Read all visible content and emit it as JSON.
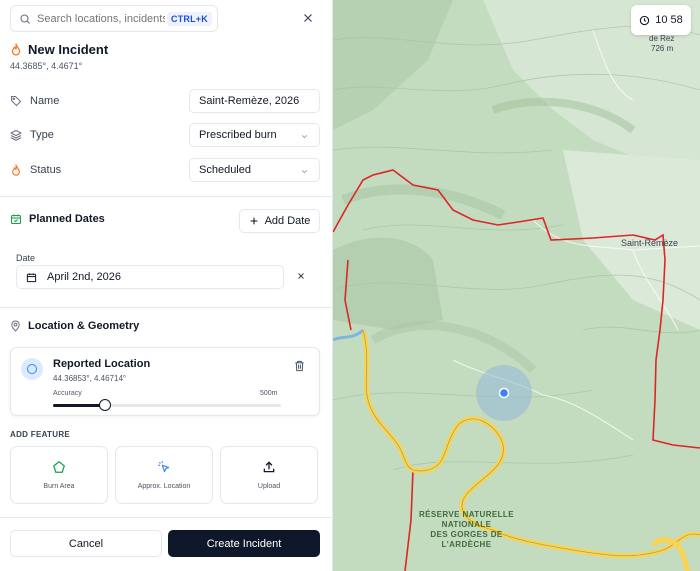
{
  "search": {
    "placeholder": "Search locations, incidents...",
    "shortcut": "CTRL+K"
  },
  "incident": {
    "title": "New Incident",
    "coords": "44.3685°, 4.4671°"
  },
  "fields": {
    "name_label": "Name",
    "name_value": "Saint-Remèze, 2026",
    "type_label": "Type",
    "type_value": "Prescribed burn",
    "status_label": "Status",
    "status_value": "Scheduled"
  },
  "planned": {
    "title": "Planned Dates",
    "add_label": "Add Date",
    "date_label": "Date",
    "date_value": "April 2nd, 2026"
  },
  "location": {
    "section_title": "Location & Geometry",
    "card_title": "Reported Location",
    "coords": "44.36853°, 4.46714°",
    "accuracy_label": "Accuracy",
    "accuracy_max": "500m",
    "accuracy_fraction": 0.23
  },
  "features": {
    "heading": "ADD FEATURE",
    "items": [
      {
        "label": "Burn Area",
        "icon": "pentagon-icon"
      },
      {
        "label": "Approx. Location",
        "icon": "cursor-click-icon"
      },
      {
        "label": "Upload",
        "icon": "upload-icon"
      }
    ]
  },
  "actions": {
    "cancel": "Cancel",
    "create": "Create Incident"
  },
  "map": {
    "clock": "10 58",
    "labels": {
      "rez": "de Rez",
      "elevation": "726 m",
      "town": "Saint-Remèze"
    },
    "reserve": [
      "RÉSERVE NATURELLE",
      "NATIONALE",
      "DES GORGES DE",
      "L'ARDÈCHE"
    ]
  },
  "colors": {
    "accent": "#0f172a",
    "fire": "#f97316",
    "boundary": "#dc2626",
    "river": "#facc15",
    "marker": "#3b82f6",
    "calendar": "#16a34a"
  }
}
